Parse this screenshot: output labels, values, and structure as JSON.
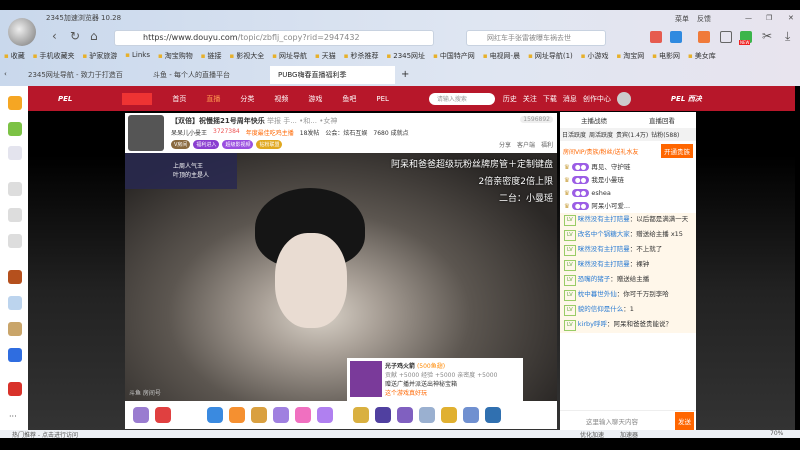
{
  "browser": {
    "title": "2345加速浏览器 10.28",
    "url_host": "https://www.douyu.com",
    "url_path": "/topic/zbflj_copy?rid=2947432",
    "search_placeholder": "网红车手张雷被曝车祸去世",
    "menu": "菜单",
    "feedback": "反馈",
    "new_badge": "NEW"
  },
  "bookmarks": [
    "收藏",
    "手机收藏夹",
    "驴家旅游",
    "Links",
    "淘宝购物",
    "链接",
    "影视大全",
    "网址导航",
    "天猫",
    "秒杀推荐",
    "2345网址",
    "中国特产网",
    "电视网-晨",
    "网址导航(1)",
    "小游戏",
    "淘宝网",
    "电影网",
    "美女库"
  ],
  "tabs": [
    "2345网址导航 - 致力于打造百",
    "斗鱼 - 每个人的直播平台",
    "PUBG嗨春直播福利季"
  ],
  "nav": {
    "logo": "PEL",
    "items": [
      "首页",
      "直播",
      "分类",
      "视频",
      "游戏",
      "鱼吧",
      "PEL"
    ],
    "search_placeholder": "请输入搜索",
    "right": [
      "历史",
      "关注",
      "下载",
      "消息",
      "创作中心"
    ],
    "brand": "PEL 西决"
  },
  "stream": {
    "title": "【双倍】祝慢摇21号周年快乐",
    "tags": [
      "举报",
      "手...",
      "•和...",
      "•女神"
    ],
    "streamer": "呆呆儿小曼王",
    "hot": "3727384",
    "rank": "年度最佳吃鸡主播",
    "fans": "18发帖",
    "guild": "公会：炫石互娱",
    "achievement": "7680 成就点",
    "room_id": "1596892",
    "badges": [
      "V房间",
      "福利进入",
      "超级影视频",
      "钻粉联盟"
    ],
    "share": "分享",
    "client": "客户端",
    "welfare": "福利"
  },
  "video": {
    "overlay_lines": [
      "阿呆和爸爸超级玩粉丝牌房管＋定制键盘",
      "2倍亲密度2倍上限",
      "二台：小曼瑶"
    ],
    "corner_text": [
      "上周人气王",
      "叶顶的主是人"
    ],
    "watermark": "斗鱼 房间号"
  },
  "gift_popup": {
    "name": "光子鸡火箭",
    "price": "(500鱼翅)",
    "stats": "贡献 +5000 经验 +5000 亲密度 +5000",
    "desc": "赠送广播并派送出神秘宝箱",
    "link": "这个游戏真好玩"
  },
  "chat": {
    "top_links": [
      "主播战绩",
      "直播回看"
    ],
    "tabs": [
      "日活跃度",
      "周活跃度",
      "贵宾(1.4万)",
      "钻粉(588)"
    ],
    "vip_promo": "房间VIP/贵族/粉丝/送礼水友",
    "vip_button": "开通贵族",
    "users": [
      "再见、守护琏",
      "我是小曼琏",
      "eshea",
      "阿呆小可爱..."
    ],
    "messages": [
      {
        "nick": "咪然没有主打陪曼",
        "text": "以后都是满满一天"
      },
      {
        "nick": "改名中个锅糖大家",
        "text": "赠送给主播 x15"
      },
      {
        "nick": "咪然没有主打陪曼",
        "text": "不上就了"
      },
      {
        "nick": "咪然没有主打陪曼",
        "text": "裸钟"
      },
      {
        "nick": "恐嘴的猪子",
        "text": "赠送给主播"
      },
      {
        "nick": "枕中暮世外仙",
        "text": "你可千万别李哈"
      },
      {
        "nick": "貌的信仰是什么",
        "text": "1"
      },
      {
        "nick": "kirby呼呼",
        "text": "阿呆和爸爸贵能说？"
      }
    ],
    "input_placeholder": "这里输入聊天内容",
    "send": "发送"
  },
  "status": {
    "left": "热门推荐 - 点击进行访问",
    "speed": "优化加速",
    "accel": "加速器",
    "zoom": "70%"
  }
}
